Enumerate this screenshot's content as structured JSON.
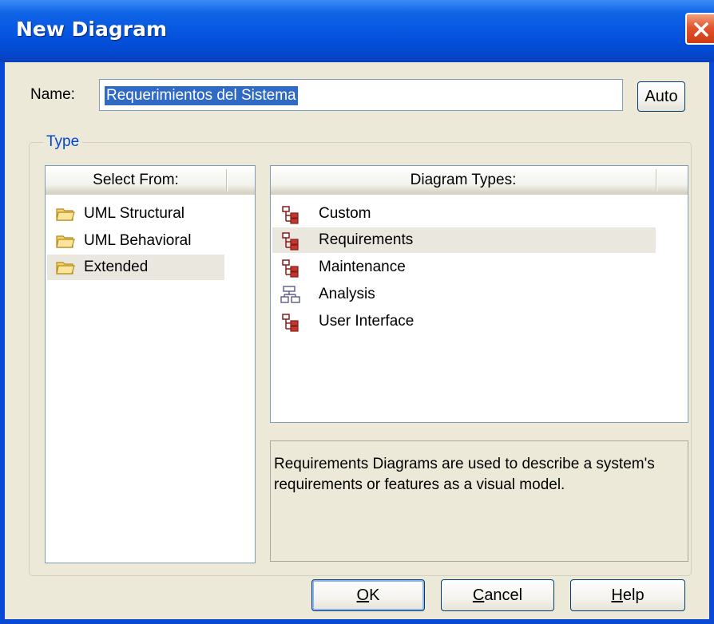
{
  "window": {
    "title": "New Diagram"
  },
  "name": {
    "label": "Name:",
    "value": "Requerimientos del Sistema",
    "auto_button": "Auto"
  },
  "type_group": {
    "title": "Type"
  },
  "select_from": {
    "header": "Select From:",
    "items": [
      {
        "label": "UML Structural",
        "icon": "folder-icon",
        "selected": false
      },
      {
        "label": "UML Behavioral",
        "icon": "folder-icon",
        "selected": false
      },
      {
        "label": "Extended",
        "icon": "folder-icon",
        "selected": true
      }
    ]
  },
  "diagram_types": {
    "header": "Diagram Types:",
    "items": [
      {
        "label": "Custom",
        "icon": "tree-diagram-icon",
        "selected": false
      },
      {
        "label": "Requirements",
        "icon": "tree-diagram-icon",
        "selected": true
      },
      {
        "label": "Maintenance",
        "icon": "tree-diagram-icon",
        "selected": false
      },
      {
        "label": "Analysis",
        "icon": "analysis-diagram-icon",
        "selected": false
      },
      {
        "label": "User Interface",
        "icon": "tree-diagram-icon",
        "selected": false
      }
    ]
  },
  "description": "Requirements Diagrams are used to describe a system's requirements or features as a visual model.",
  "buttons": {
    "ok": {
      "mnemonic": "O",
      "rest": "K"
    },
    "cancel": {
      "mnemonic": "C",
      "rest": "ancel"
    },
    "help": {
      "mnemonic": "H",
      "rest": "elp"
    }
  },
  "colors": {
    "titlebar": "#0554e0",
    "selection": "#316ac5",
    "group_title": "#0046d5",
    "close_button": "#e2562e"
  }
}
